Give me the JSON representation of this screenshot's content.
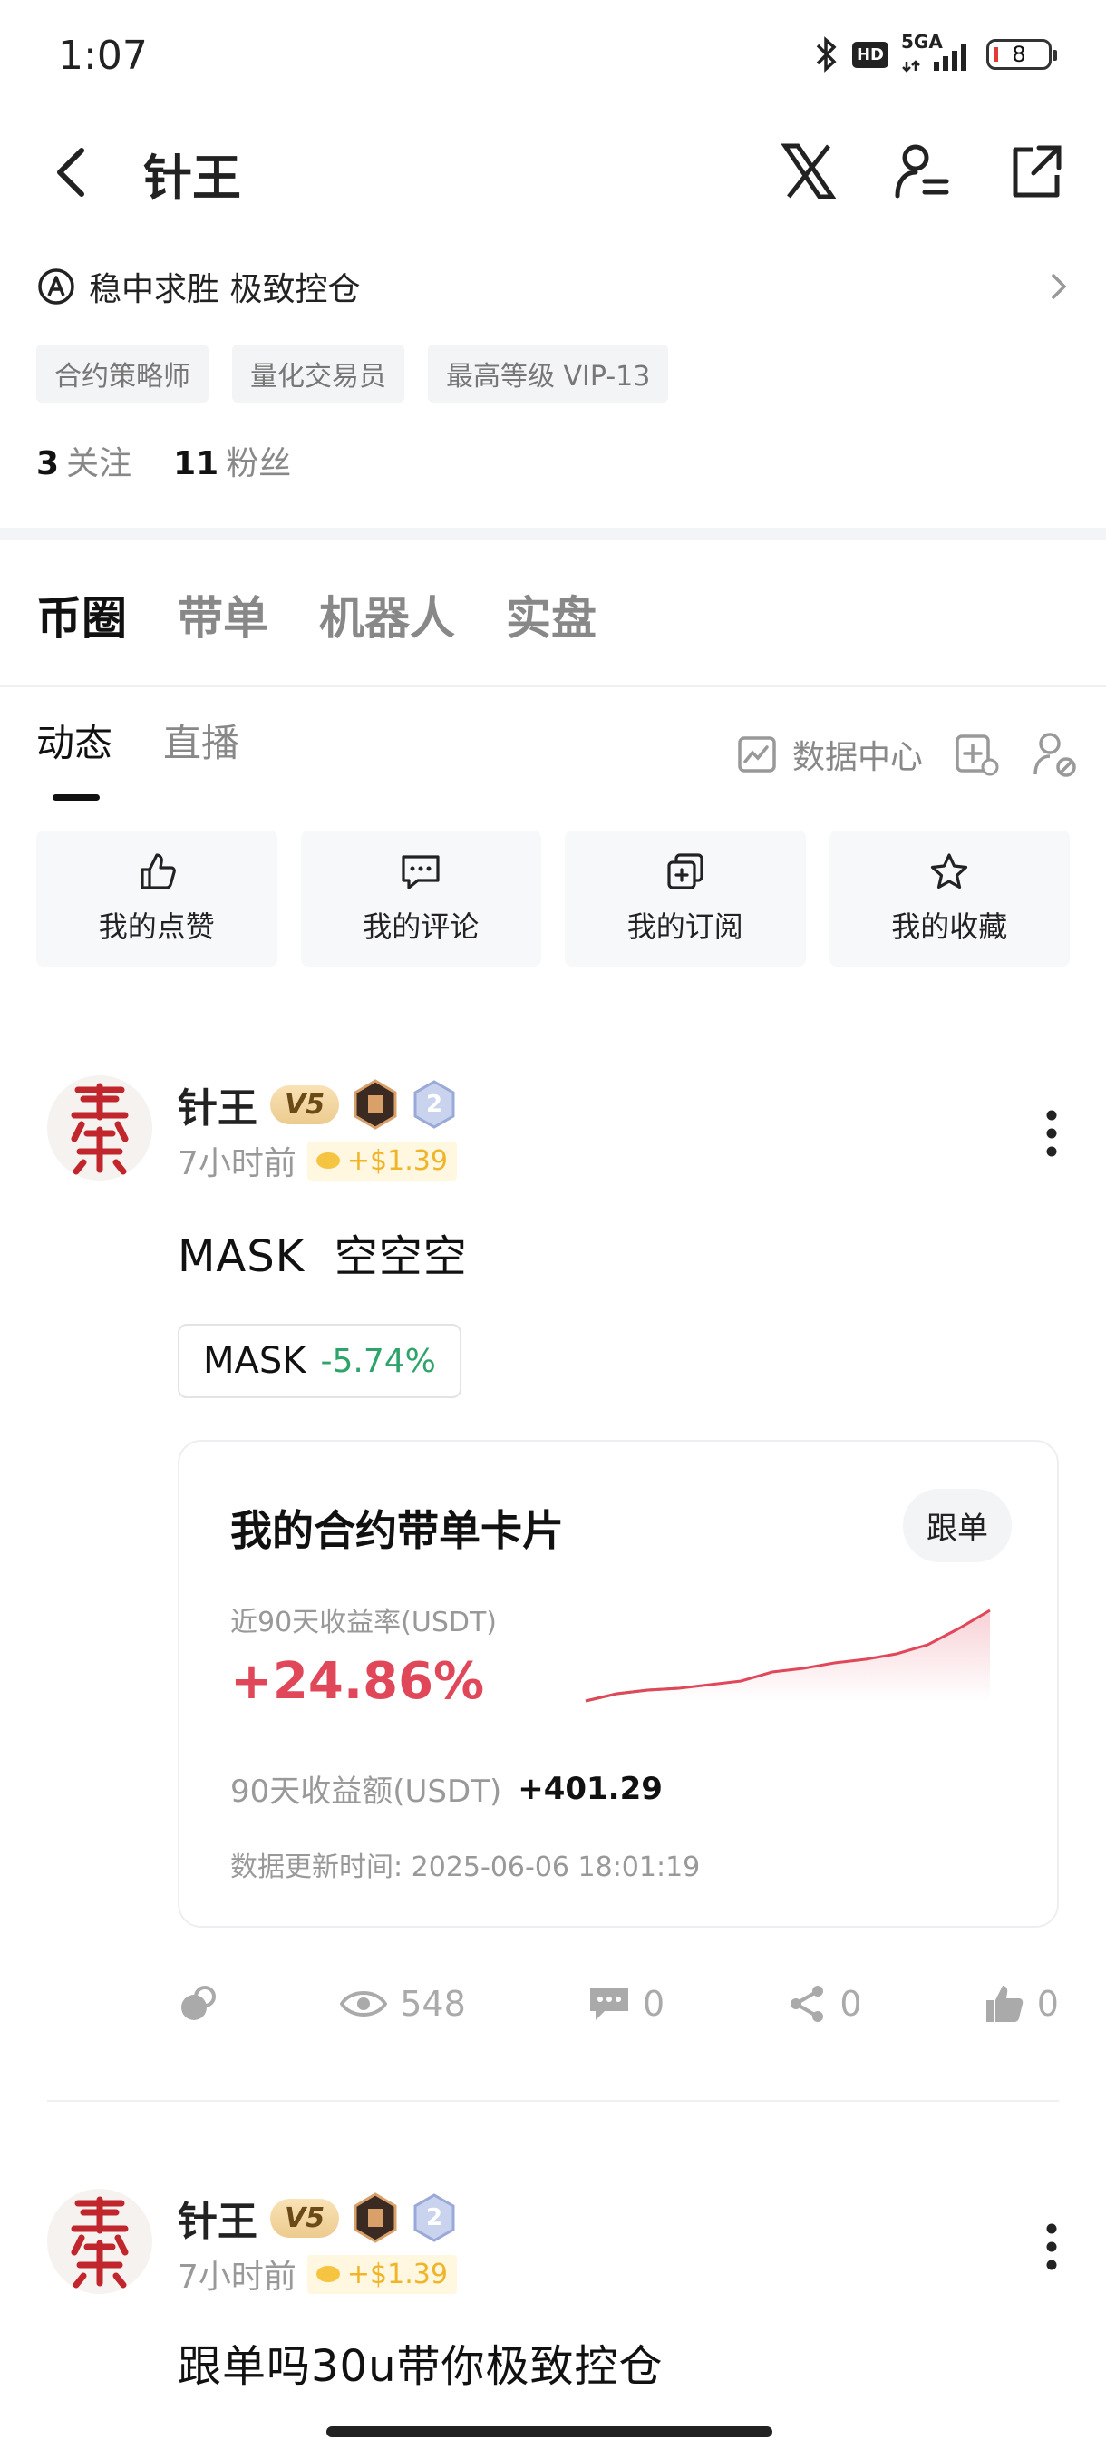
{
  "status": {
    "time": "1:07",
    "network": "5GA",
    "hd": "HD",
    "battery": "8"
  },
  "header": {
    "title": "针王"
  },
  "profile": {
    "bio": "稳中求胜 极致控仓",
    "tags": [
      "合约策略师",
      "量化交易员",
      "最高等级 VIP-13"
    ],
    "following_count": "3",
    "following_label": "关注",
    "followers_count": "11",
    "followers_label": "粉丝"
  },
  "main_tabs": [
    "币圈",
    "带单",
    "机器人",
    "实盘"
  ],
  "sub_tabs": [
    "动态",
    "直播"
  ],
  "sub_tools": {
    "data_center": "数据中心"
  },
  "quick_actions": [
    "我的点赞",
    "我的评论",
    "我的订阅",
    "我的收藏"
  ],
  "posts": [
    {
      "author": "针王",
      "level": "V5",
      "rank_badge": "2",
      "time": "7小时前",
      "reward": "+$1.39",
      "text": "MASK  空空空",
      "coin": {
        "symbol": "MASK",
        "change": "-5.74%"
      },
      "card": {
        "title": "我的合约带单卡片",
        "follow_label": "跟单",
        "yield_label": "近90天收益率(USDT)",
        "yield_value": "+24.86%",
        "profit_label": "90天收益额(USDT)",
        "profit_value": "+401.29",
        "update_text": "数据更新时间: 2025-06-06 18:01:19",
        "sparkline": [
          0.0,
          0.08,
          0.12,
          0.14,
          0.18,
          0.22,
          0.32,
          0.36,
          0.42,
          0.46,
          0.52,
          0.62,
          0.8,
          1.0
        ]
      },
      "stats": {
        "views": "548",
        "comments": "0",
        "shares": "0",
        "likes": "0"
      }
    },
    {
      "author": "针王",
      "level": "V5",
      "rank_badge": "2",
      "time": "7小时前",
      "reward": "+$1.39",
      "text": "跟单吗30u带你极致控仓"
    }
  ],
  "colors": {
    "up_green": "#2ea36a",
    "down_red": "#e0485a",
    "reward_gold": "#f0b428"
  }
}
